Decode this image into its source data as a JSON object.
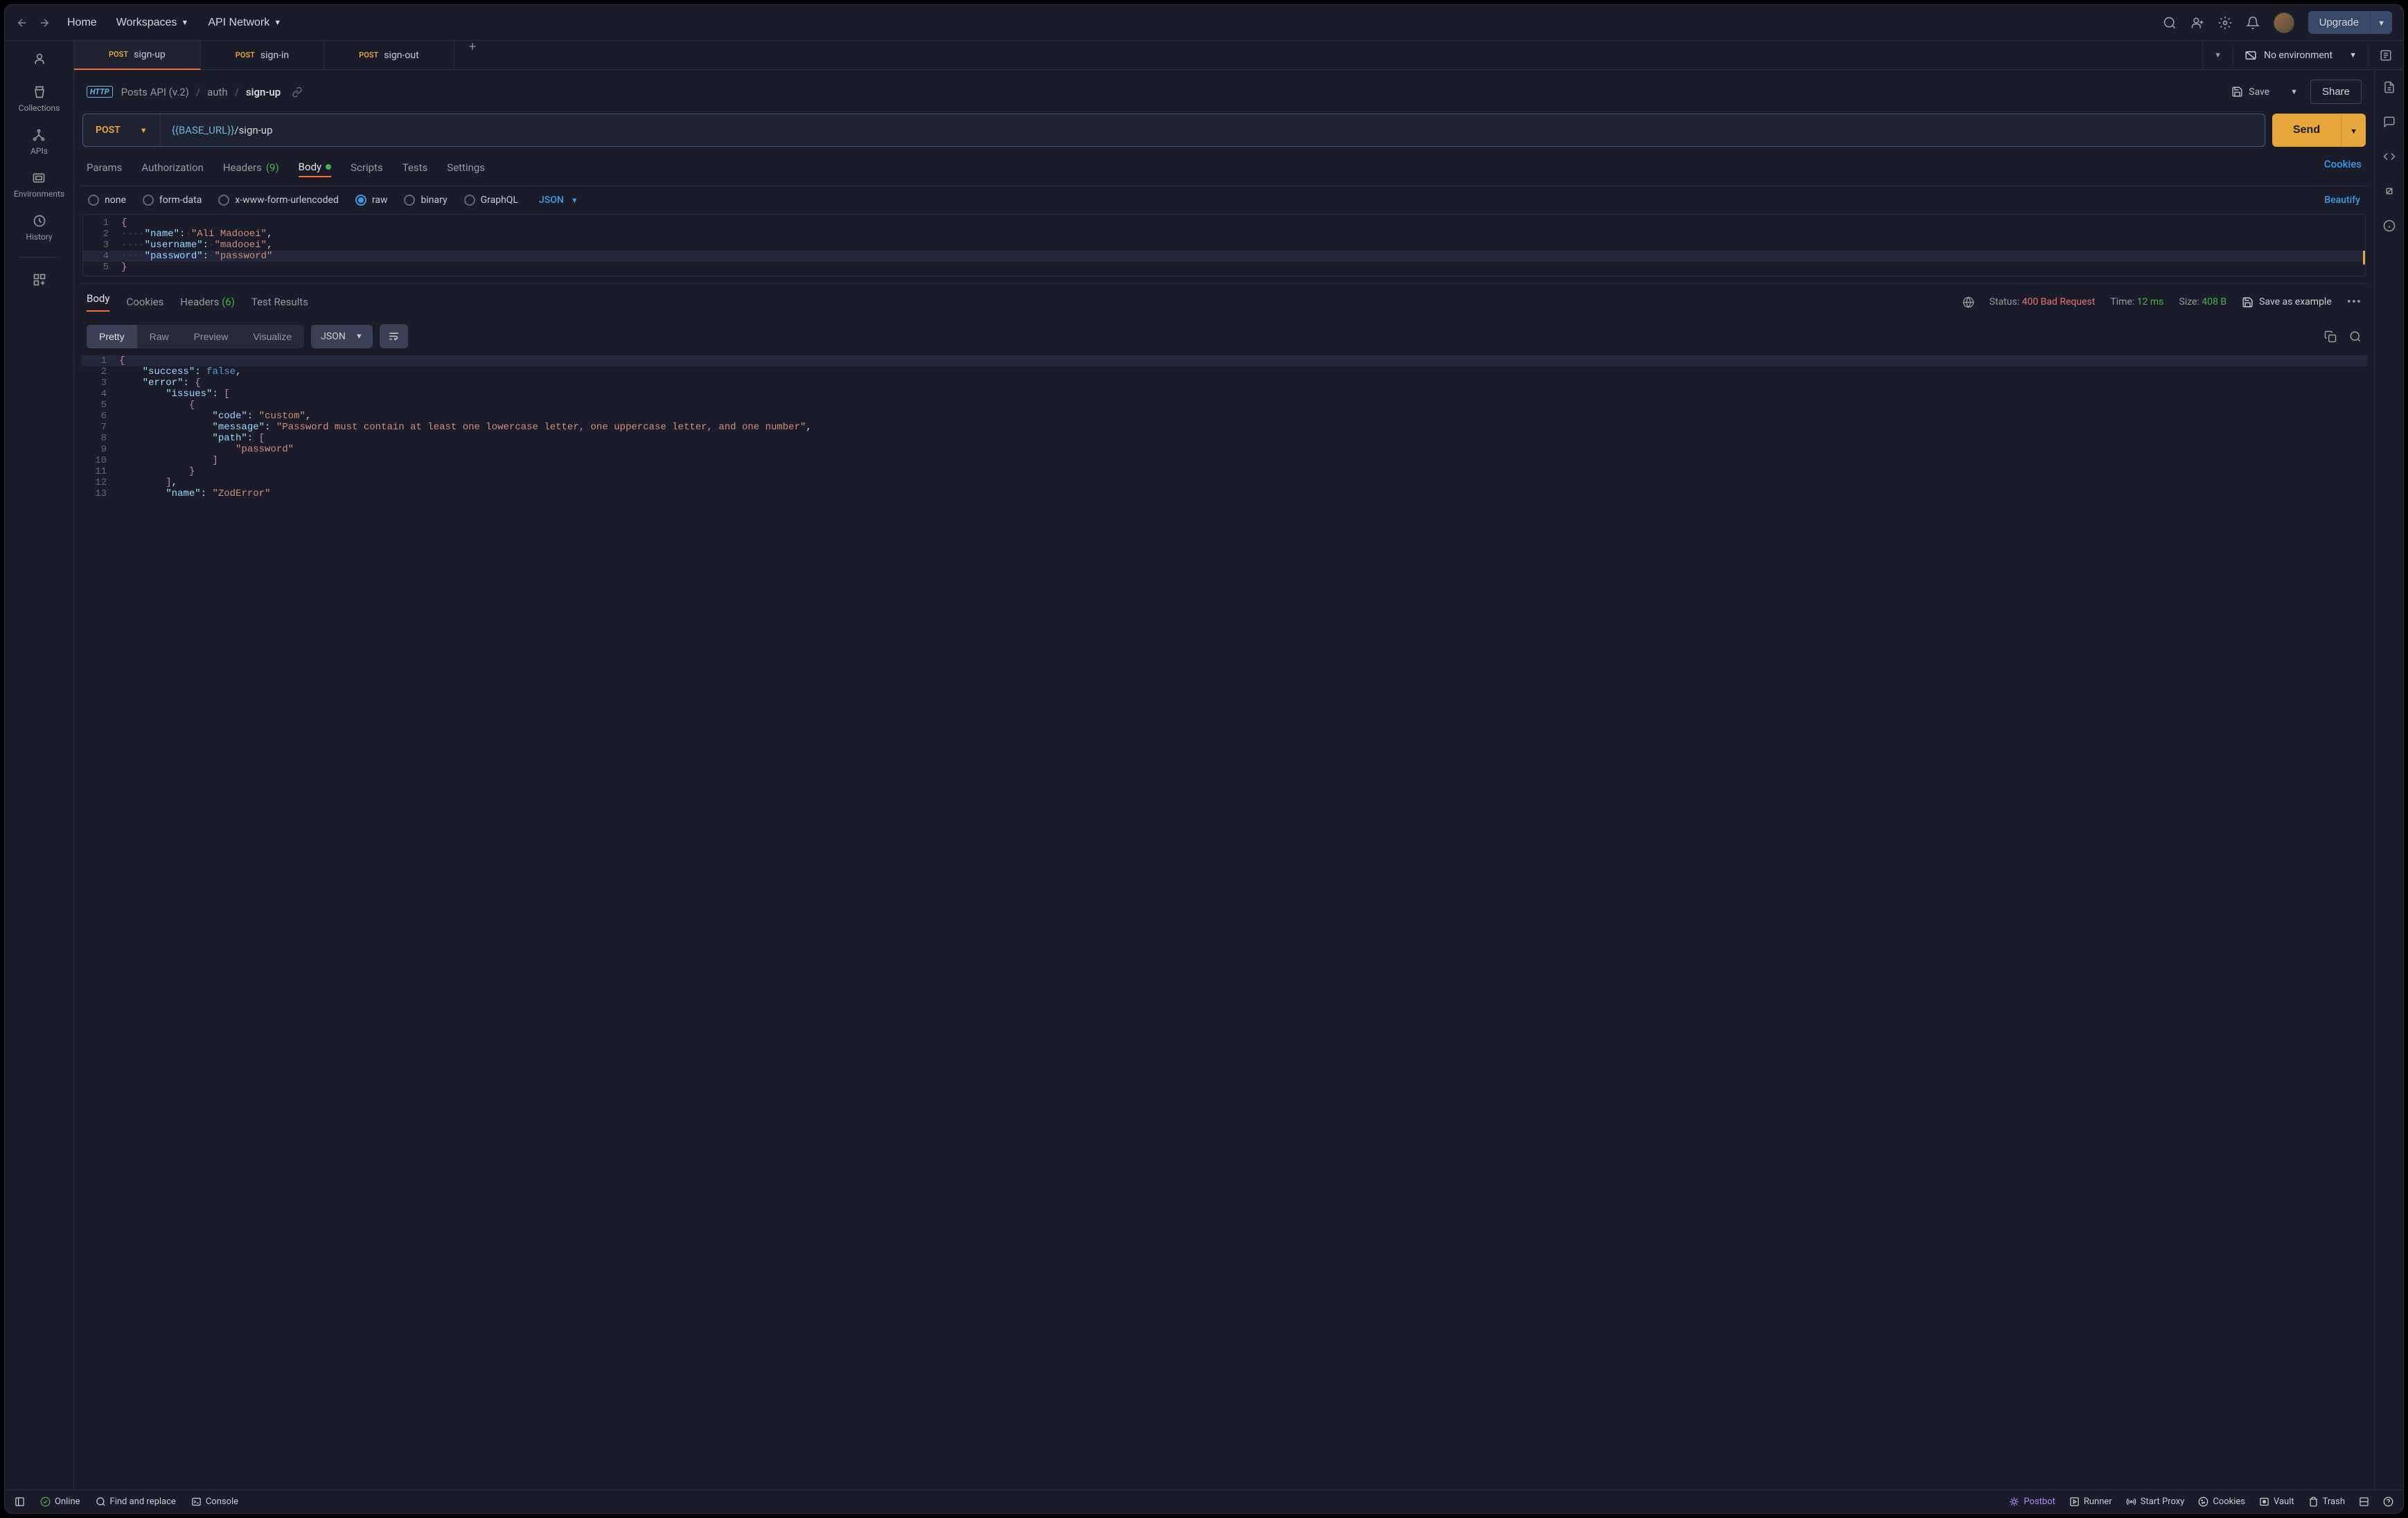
{
  "topbar": {
    "home": "Home",
    "workspaces": "Workspaces",
    "api_network": "API Network",
    "upgrade": "Upgrade"
  },
  "left_rail": {
    "collections": "Collections",
    "apis": "APIs",
    "environments": "Environments",
    "history": "History"
  },
  "tabs": [
    {
      "method": "POST",
      "name": "sign-up",
      "active": true
    },
    {
      "method": "POST",
      "name": "sign-in",
      "active": false
    },
    {
      "method": "POST",
      "name": "sign-out",
      "active": false
    }
  ],
  "environment": {
    "label": "No environment"
  },
  "breadcrumb": {
    "root": "Posts API (v.2)",
    "group": "auth",
    "item": "sign-up",
    "save": "Save",
    "share": "Share"
  },
  "request": {
    "method": "POST",
    "url_var": "{{BASE_URL}}",
    "url_path": "/sign-up",
    "send": "Send"
  },
  "req_tabs": {
    "params": "Params",
    "authorization": "Authorization",
    "headers": "Headers",
    "headers_count": "(9)",
    "body": "Body",
    "scripts": "Scripts",
    "tests": "Tests",
    "settings": "Settings",
    "cookies": "Cookies"
  },
  "body_types": {
    "none": "none",
    "form_data": "form-data",
    "url_encoded": "x-www-form-urlencoded",
    "raw": "raw",
    "binary": "binary",
    "graphql": "GraphQL",
    "format": "JSON",
    "beautify": "Beautify"
  },
  "request_body": {
    "name_key": "\"name\"",
    "name_val": "\"Ali Madooei\"",
    "username_key": "\"username\"",
    "username_val": "\"madooei\"",
    "password_key": "\"password\"",
    "password_val": "\"password\""
  },
  "response_tabs": {
    "body": "Body",
    "cookies": "Cookies",
    "headers": "Headers",
    "headers_count": "(6)",
    "test_results": "Test Results"
  },
  "response_meta": {
    "status_label": "Status:",
    "status_code": "400",
    "status_text": "Bad Request",
    "time_label": "Time:",
    "time_val": "12 ms",
    "size_label": "Size:",
    "size_val": "408 B",
    "save_example": "Save as example"
  },
  "response_views": {
    "pretty": "Pretty",
    "raw": "Raw",
    "preview": "Preview",
    "visualize": "Visualize",
    "format": "JSON"
  },
  "response_body": {
    "success_key": "\"success\"",
    "success_val": "false",
    "error_key": "\"error\"",
    "issues_key": "\"issues\"",
    "code_key": "\"code\"",
    "code_val": "\"custom\"",
    "message_key": "\"message\"",
    "message_val": "\"Password must contain at least one lowercase letter, one uppercase letter, and one number\"",
    "path_key": "\"path\"",
    "path_val": "\"password\"",
    "name_key": "\"name\"",
    "name_val": "\"ZodError\""
  },
  "footer": {
    "online": "Online",
    "find_replace": "Find and replace",
    "console": "Console",
    "postbot": "Postbot",
    "runner": "Runner",
    "start_proxy": "Start Proxy",
    "cookies": "Cookies",
    "vault": "Vault",
    "trash": "Trash"
  }
}
